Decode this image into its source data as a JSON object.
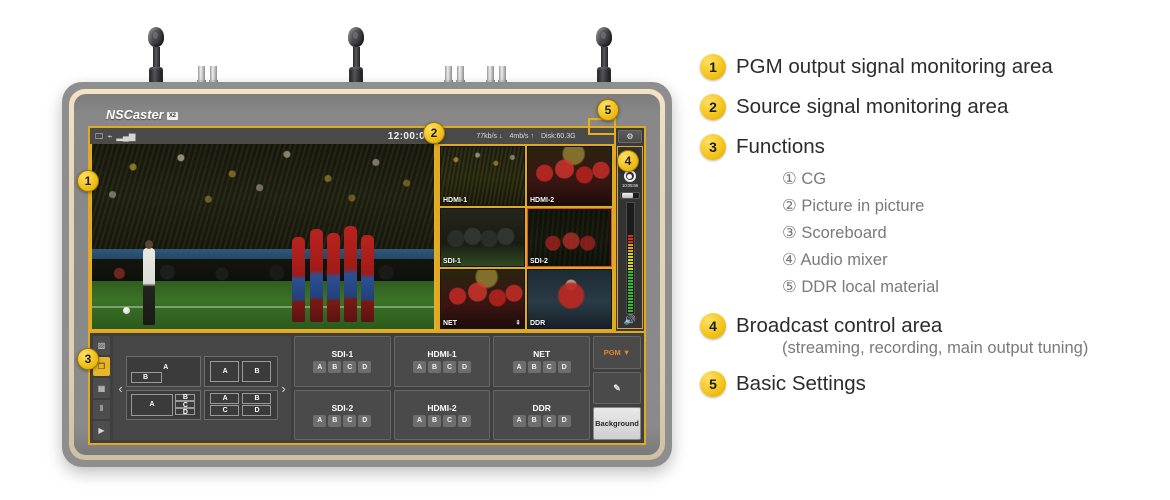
{
  "device": {
    "brand": "NSCaster",
    "brand_badge": "X2",
    "status_bar": {
      "icons": [
        "monitor-icon",
        "wifi-icon",
        "signal-icon"
      ],
      "clock": "12:00:00"
    },
    "sources_status": {
      "download": "77kb/s ↓",
      "upload": "4mb/s ↑",
      "disk": "Disk:60.3G"
    },
    "sources": [
      {
        "label": "HDMI-1",
        "active": false,
        "thumb": "t-crowdY",
        "icon": ""
      },
      {
        "label": "HDMI-2",
        "active": false,
        "thumb": "t-red",
        "icon": ""
      },
      {
        "label": "SDI-1",
        "active": false,
        "thumb": "t-dark",
        "icon": ""
      },
      {
        "label": "SDI-2",
        "active": true,
        "thumb": "t-night",
        "icon": ""
      },
      {
        "label": "NET",
        "active": false,
        "thumb": "t-red",
        "icon": "⇞"
      },
      {
        "label": "DDR",
        "active": false,
        "thumb": "t-solo",
        "icon": ""
      }
    ],
    "rail": {
      "settings_icon": "gear-icon",
      "stream_icon": "cloud-stream-icon",
      "record_icon": "record-icon",
      "record_timer": "10:05:56",
      "volume_label": "volume-slider",
      "speaker_icon": "🔊"
    },
    "functions_strip": [
      {
        "name": "cg",
        "icon": "▨",
        "selected": false
      },
      {
        "name": "picture-in-picture",
        "icon": "❐",
        "selected": true
      },
      {
        "name": "scoreboard",
        "icon": "▦",
        "selected": false
      },
      {
        "name": "audio-mixer",
        "icon": "⦀",
        "selected": false
      },
      {
        "name": "ddr",
        "icon": "▶",
        "selected": false
      }
    ],
    "layouts": {
      "prev_arrow": "‹",
      "next_arrow": "›",
      "presets": [
        {
          "name": "pip",
          "labels": [
            "A",
            "B"
          ]
        },
        {
          "name": "side-by-side",
          "labels": [
            "A",
            "B"
          ]
        },
        {
          "name": "one-plus-three",
          "labels": [
            "A",
            "B",
            "C",
            "D"
          ]
        },
        {
          "name": "quad",
          "labels": [
            "A",
            "B",
            "C",
            "D"
          ]
        }
      ]
    },
    "channels": [
      {
        "name": "SDI-1",
        "buttons": [
          "A",
          "B",
          "C",
          "D"
        ]
      },
      {
        "name": "HDMI-1",
        "buttons": [
          "A",
          "B",
          "C",
          "D"
        ]
      },
      {
        "name": "NET",
        "buttons": [
          "A",
          "B",
          "C",
          "D"
        ]
      },
      {
        "name": "SDI-2",
        "buttons": [
          "A",
          "B",
          "C",
          "D"
        ]
      },
      {
        "name": "HDMI-2",
        "buttons": [
          "A",
          "B",
          "C",
          "D"
        ]
      },
      {
        "name": "DDR",
        "buttons": [
          "A",
          "B",
          "C",
          "D"
        ]
      }
    ],
    "right_buttons": {
      "pgm": "PGM ▼",
      "edit": "✎",
      "background": "Background"
    },
    "callouts": [
      "1",
      "2",
      "3",
      "4",
      "5"
    ]
  },
  "legend": {
    "items": [
      {
        "num": "1",
        "title": "PGM output signal monitoring area"
      },
      {
        "num": "2",
        "title": "Source signal monitoring area"
      },
      {
        "num": "3",
        "title": "Functions"
      },
      {
        "num": "4",
        "title": "Broadcast control area"
      },
      {
        "num": "5",
        "title": "Basic Settings"
      }
    ],
    "functions_sub": [
      "① CG",
      "② Picture in picture",
      "③ Scoreboard",
      "④ Audio mixer",
      "⑤ DDR local material"
    ],
    "broadcast_sub": "(streaming, recording, main output tuning)"
  },
  "colors": {
    "accent_yellow": "#e7b52a",
    "badge_yellow": "#f2c319",
    "program_red": "#d9511f",
    "stream_orange": "#e8852c"
  }
}
